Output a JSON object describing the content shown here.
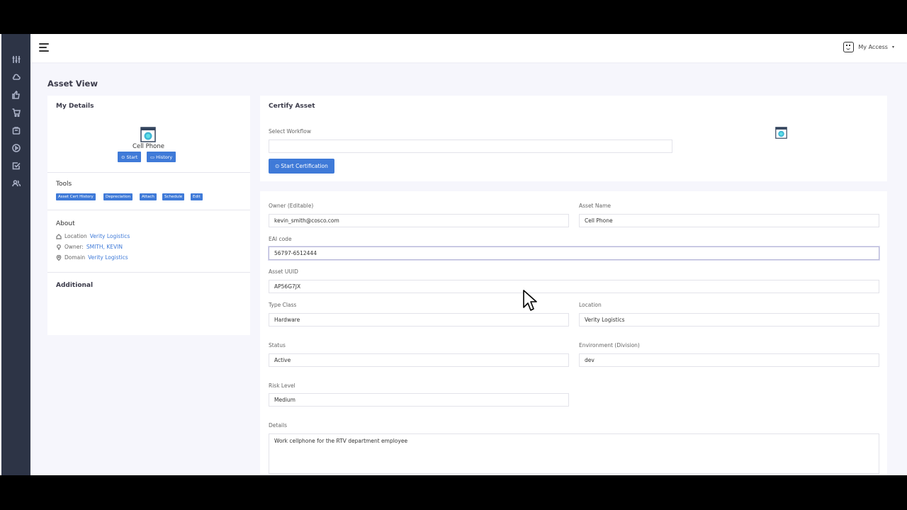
{
  "header": {
    "access_label": "My Access",
    "access_chevron": "▾"
  },
  "sidebar": {
    "icons": [
      "sliders-icon",
      "cloud-icon",
      "thumbs-up-icon",
      "cart-icon",
      "bag-icon",
      "play-circle-icon",
      "check-square-icon",
      "users-icon"
    ]
  },
  "page": {
    "title": "Asset View"
  },
  "my_details": {
    "title": "My Details",
    "device_name": "Cell Phone",
    "start_label": "Start",
    "history_label": "History"
  },
  "tools": {
    "title": "Tools",
    "tags": [
      "Asset Cert History",
      "Depreciation",
      "Attach",
      "Schedule",
      "Edit"
    ]
  },
  "about": {
    "title": "About",
    "location_label": "Location",
    "location_value": "Verity Logistics",
    "owner_label": "Owner:",
    "owner_value": "SMITH, KEVIN",
    "domain_label": "Domain",
    "domain_value": "Verity Logistics"
  },
  "additional": {
    "title": "Additional"
  },
  "certify": {
    "title": "Certify Asset",
    "workflow_label": "Select Workflow",
    "workflow_value": "",
    "start_button": "Start Certification"
  },
  "form": {
    "owner_label": "Owner (Editable)",
    "owner_value": "kevin_smith@cosco.com",
    "asset_name_label": "Asset Name",
    "asset_name_value": "Cell Phone",
    "eai_label": "EAI code",
    "eai_value": "56797-6512444",
    "uuid_label": "Asset UUID",
    "uuid_value": "AP56G7JX",
    "type_label": "Type Class",
    "type_value": "Hardware",
    "location_label": "Location",
    "location_value": "Verity Logistics",
    "status_label": "Status",
    "status_value": "Active",
    "env_label": "Environment (Division)",
    "env_value": "dev",
    "risk_label": "Risk Level",
    "risk_value": "Medium",
    "details_label": "Details",
    "details_value": "Work cellphone for the RTV department employee"
  },
  "colors": {
    "accent": "#3f7ad8",
    "sidebar": "#2d3446",
    "background": "#f6f6fc"
  }
}
